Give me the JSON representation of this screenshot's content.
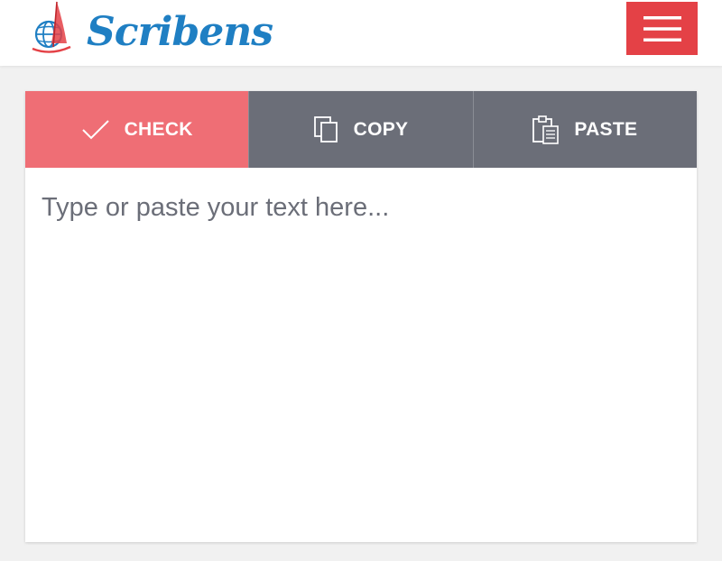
{
  "header": {
    "logo_text": "Scribens",
    "logo_icon": "globe-sail-icon",
    "menu_icon": "hamburger-icon"
  },
  "toolbar": {
    "check": {
      "label": "CHECK",
      "icon": "checkmark-icon"
    },
    "copy": {
      "label": "COPY",
      "icon": "copy-icon"
    },
    "paste": {
      "label": "PASTE",
      "icon": "clipboard-icon"
    }
  },
  "editor": {
    "value": "",
    "placeholder": "Type or paste your text here..."
  },
  "colors": {
    "brand_blue": "#1f7fc3",
    "menu_red": "#e44146",
    "check_pink": "#ef6e75",
    "tool_gray": "#6b6e78"
  }
}
